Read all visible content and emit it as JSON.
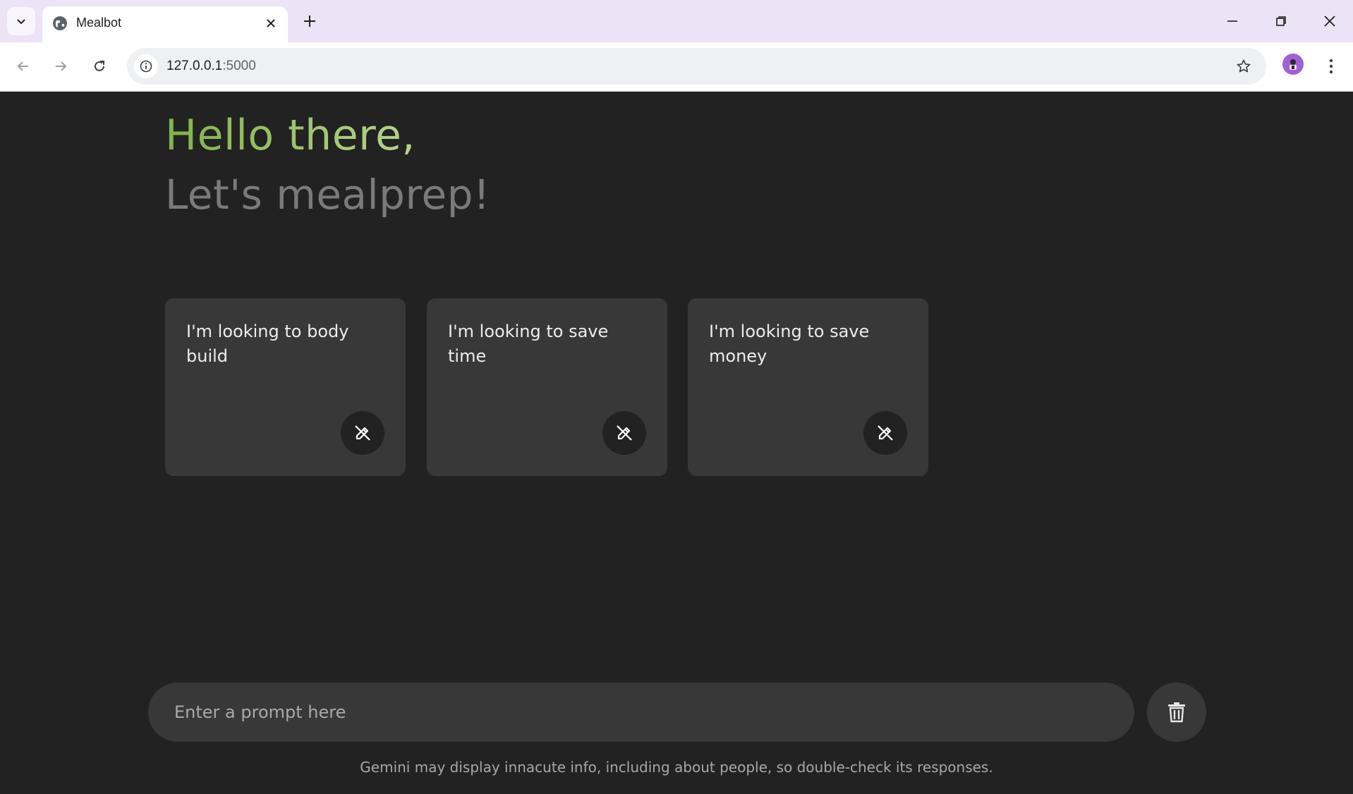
{
  "browser": {
    "tab": {
      "title": "Mealbot"
    },
    "address": {
      "host": "127.0.0.1",
      "port": ":5000"
    }
  },
  "page": {
    "greeting": "Hello there,",
    "subtitle": "Let's mealprep!",
    "cards": [
      {
        "text": "I'm looking to body build",
        "icon": "edit-icon"
      },
      {
        "text": "I'm looking to save time",
        "icon": "edit-icon"
      },
      {
        "text": "I'm looking to save money",
        "icon": "edit-icon"
      }
    ],
    "prompt": {
      "placeholder": "Enter a prompt here",
      "value": ""
    },
    "disclaimer": "Gemini may display innacute info, including about people, so double-check its responses."
  },
  "colors": {
    "background": "#222222",
    "card": "#383838",
    "greeting_gradient_start": "#7fb24a",
    "greeting_gradient_end": "#b8d38c",
    "subtitle": "#7a7a7a",
    "tabbar": "#ece3f6"
  }
}
